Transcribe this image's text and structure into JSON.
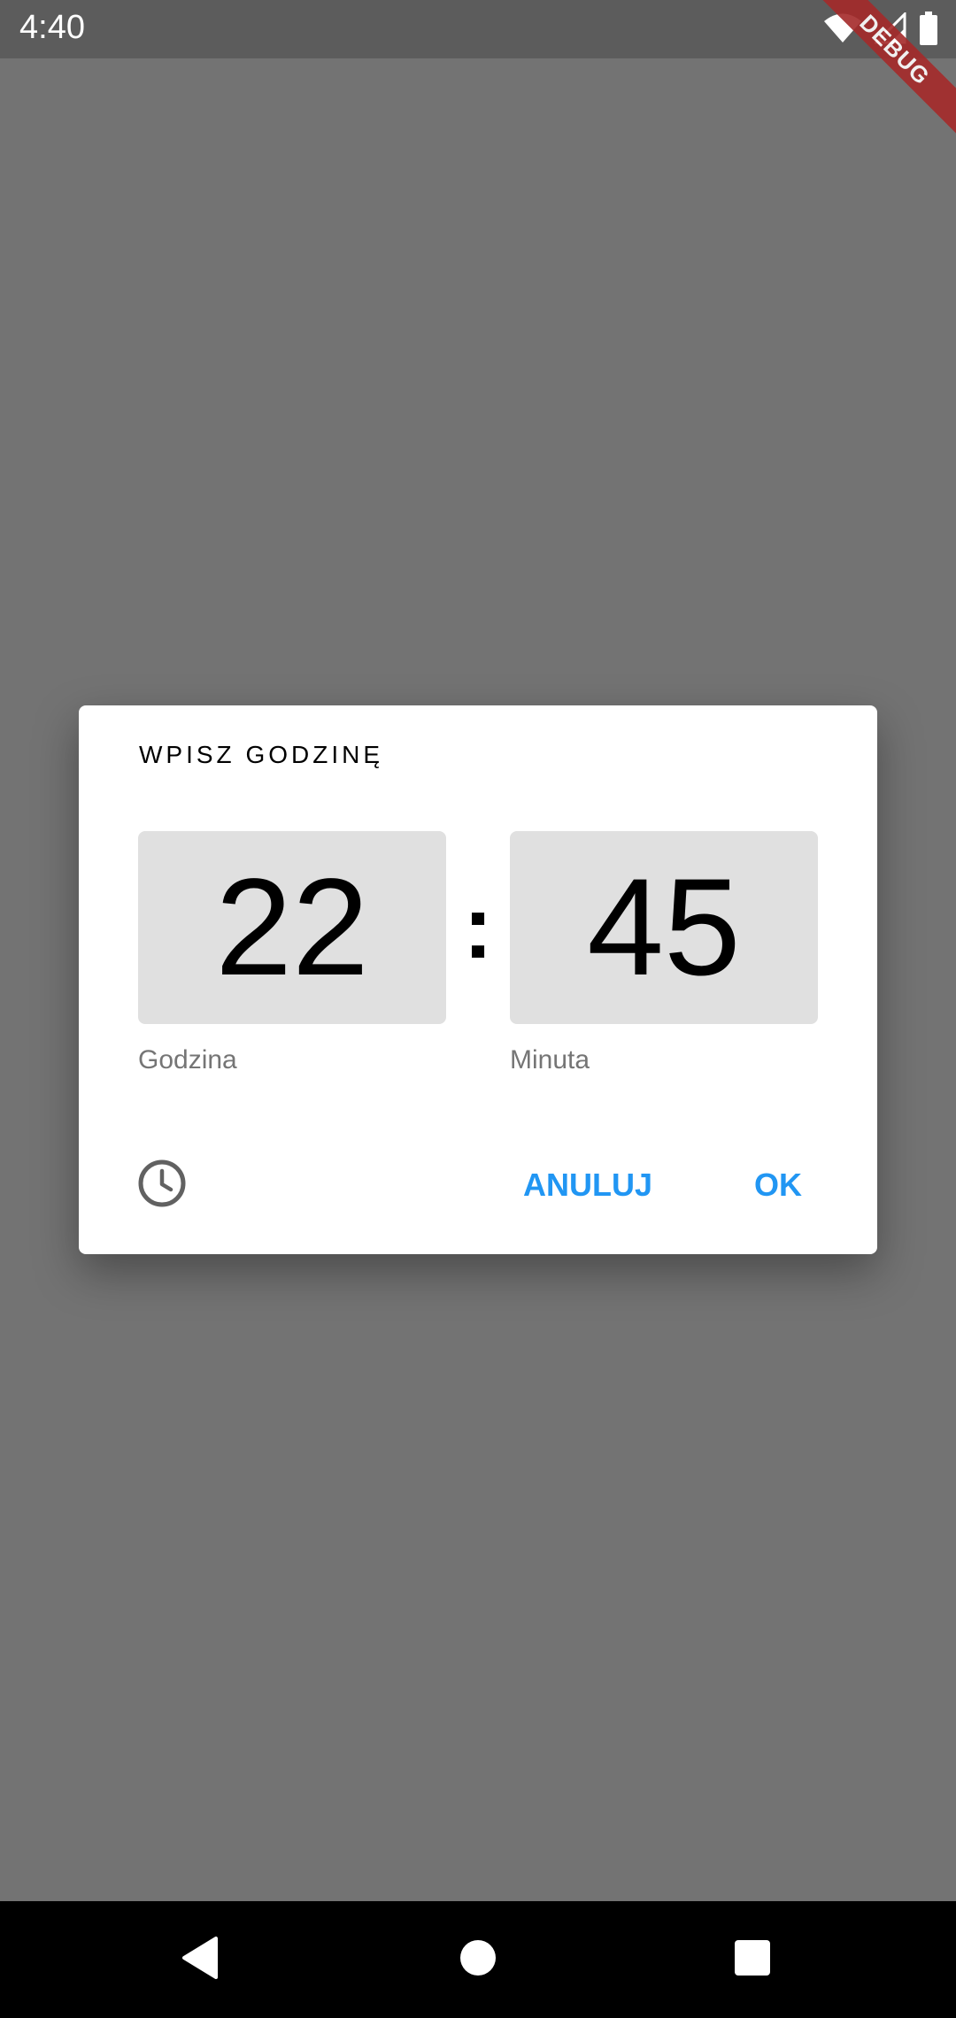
{
  "status_bar": {
    "time": "4:40",
    "icons": [
      "wifi-icon",
      "signal-icon",
      "battery-icon"
    ]
  },
  "debug_banner": {
    "label": "DEBUG",
    "color": "#a52a2a"
  },
  "dialog": {
    "title": "WPISZ GODZINĘ",
    "hour_value": "22",
    "separator": ":",
    "minute_value": "45",
    "hour_label": "Godzina",
    "minute_label": "Minuta",
    "mode_toggle_icon": "clock-icon",
    "cancel_label": "ANULUJ",
    "ok_label": "OK",
    "accent_color": "#2196f3"
  },
  "nav_bar": {
    "icons": [
      "back-icon",
      "home-icon",
      "recents-icon"
    ]
  }
}
